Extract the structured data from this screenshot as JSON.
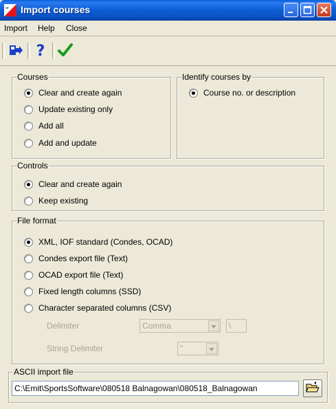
{
  "window": {
    "title": "Import courses"
  },
  "menu": [
    {
      "label": "Import",
      "accel": "I"
    },
    {
      "label": "Help",
      "accel": "H"
    },
    {
      "label": "Close",
      "accel": "C"
    }
  ],
  "toolbar": [
    {
      "icon": "exit-icon"
    },
    {
      "icon": "help-icon"
    },
    {
      "icon": "checkmark-icon"
    }
  ],
  "courses": {
    "title": "Courses",
    "options": [
      {
        "label": "Clear and create again",
        "selected": true
      },
      {
        "label": "Update existing only",
        "selected": false
      },
      {
        "label": "Add all",
        "selected": false
      },
      {
        "label": "Add and update",
        "selected": false
      }
    ]
  },
  "identify": {
    "title": "Identify courses by",
    "options": [
      {
        "label": "Course no. or description",
        "selected": true
      }
    ]
  },
  "controls": {
    "title": "Controls",
    "options": [
      {
        "label": "Clear and create again",
        "selected": true
      },
      {
        "label": "Keep existing",
        "selected": false
      }
    ]
  },
  "file_format": {
    "title": "File format",
    "options": [
      {
        "label": "XML, IOF standard (Condes, OCAD)",
        "selected": true
      },
      {
        "label": "Condes export file (Text)",
        "selected": false
      },
      {
        "label": "OCAD export file (Text)",
        "selected": false
      },
      {
        "label": "Fixed length columns (SSD)",
        "selected": false
      },
      {
        "label": "Character separated columns (CSV)",
        "selected": false
      }
    ],
    "delimiter_label": "Delimiter",
    "delimiter_value": "Comma",
    "delimiter_char": "\\",
    "string_delimiter_label": "String Delimiter",
    "string_delimiter_value": "\""
  },
  "ascii_import": {
    "title": "ASCII import file",
    "path": "C:\\Emit\\SportsSoftware\\080518 Balnagowan\\080518_Balnagowan"
  },
  "colors": {
    "titlebar": "#0A5FD8",
    "check": "#1A9A1A",
    "help": "#1A3FC8"
  }
}
